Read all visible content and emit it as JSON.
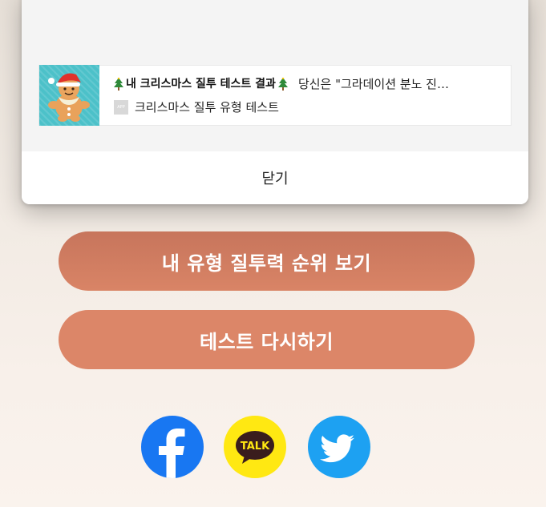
{
  "modal": {
    "preview": {
      "title": "내 크리스마스 질투 테스트 결과",
      "description": "당신은 \"그라데이션 분노 진…",
      "site_name": "크리스마스 질투 유형 테스트",
      "site_icon_label": "APP",
      "thumbnail_icon": "gingerbread-santa-icon",
      "title_decoration_icon": "christmas-tree-icon"
    },
    "close_label": "닫기"
  },
  "buttons": {
    "rank_label": "내 유형 질투력 순위 보기",
    "retry_label": "테스트 다시하기"
  },
  "social": {
    "kakao_label": "TALK",
    "icons": [
      "facebook-icon",
      "kakaotalk-icon",
      "twitter-icon"
    ]
  },
  "colors": {
    "button_primary": "#d98466",
    "facebook": "#1877f2",
    "kakao": "#ffe812",
    "twitter": "#1da1f2"
  }
}
